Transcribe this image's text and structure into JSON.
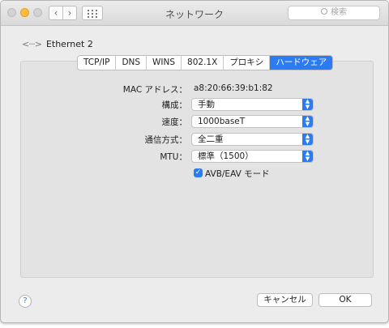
{
  "window": {
    "title": "ネットワーク"
  },
  "search": {
    "placeholder": "検索",
    "icon": "search-icon"
  },
  "interface": {
    "icon": "ethernet-icon",
    "glyph": "<···>",
    "name": "Ethernet 2"
  },
  "tabs": [
    {
      "label": "TCP/IP",
      "active": false
    },
    {
      "label": "DNS",
      "active": false
    },
    {
      "label": "WINS",
      "active": false
    },
    {
      "label": "802.1X",
      "active": false
    },
    {
      "label": "プロキシ",
      "active": false
    },
    {
      "label": "ハードウェア",
      "active": true
    }
  ],
  "hardware": {
    "mac_label": "MAC アドレス：",
    "mac_value": "a8:20:66:39:b1:82",
    "config_label": "構成：",
    "config_value": "手動",
    "speed_label": "速度：",
    "speed_value": "1000baseT",
    "duplex_label": "通信方式：",
    "duplex_value": "全二重",
    "mtu_label": "MTU：",
    "mtu_value": "標準（1500）",
    "avb_label": "AVB/EAV モード",
    "avb_checked": true
  },
  "footer": {
    "help": "?",
    "cancel_label": "キャンセル",
    "ok_label": "OK"
  },
  "colors": {
    "accent": "#2b7bf2",
    "window_bg": "#ececec",
    "panel_bg": "#e3e3e3"
  }
}
